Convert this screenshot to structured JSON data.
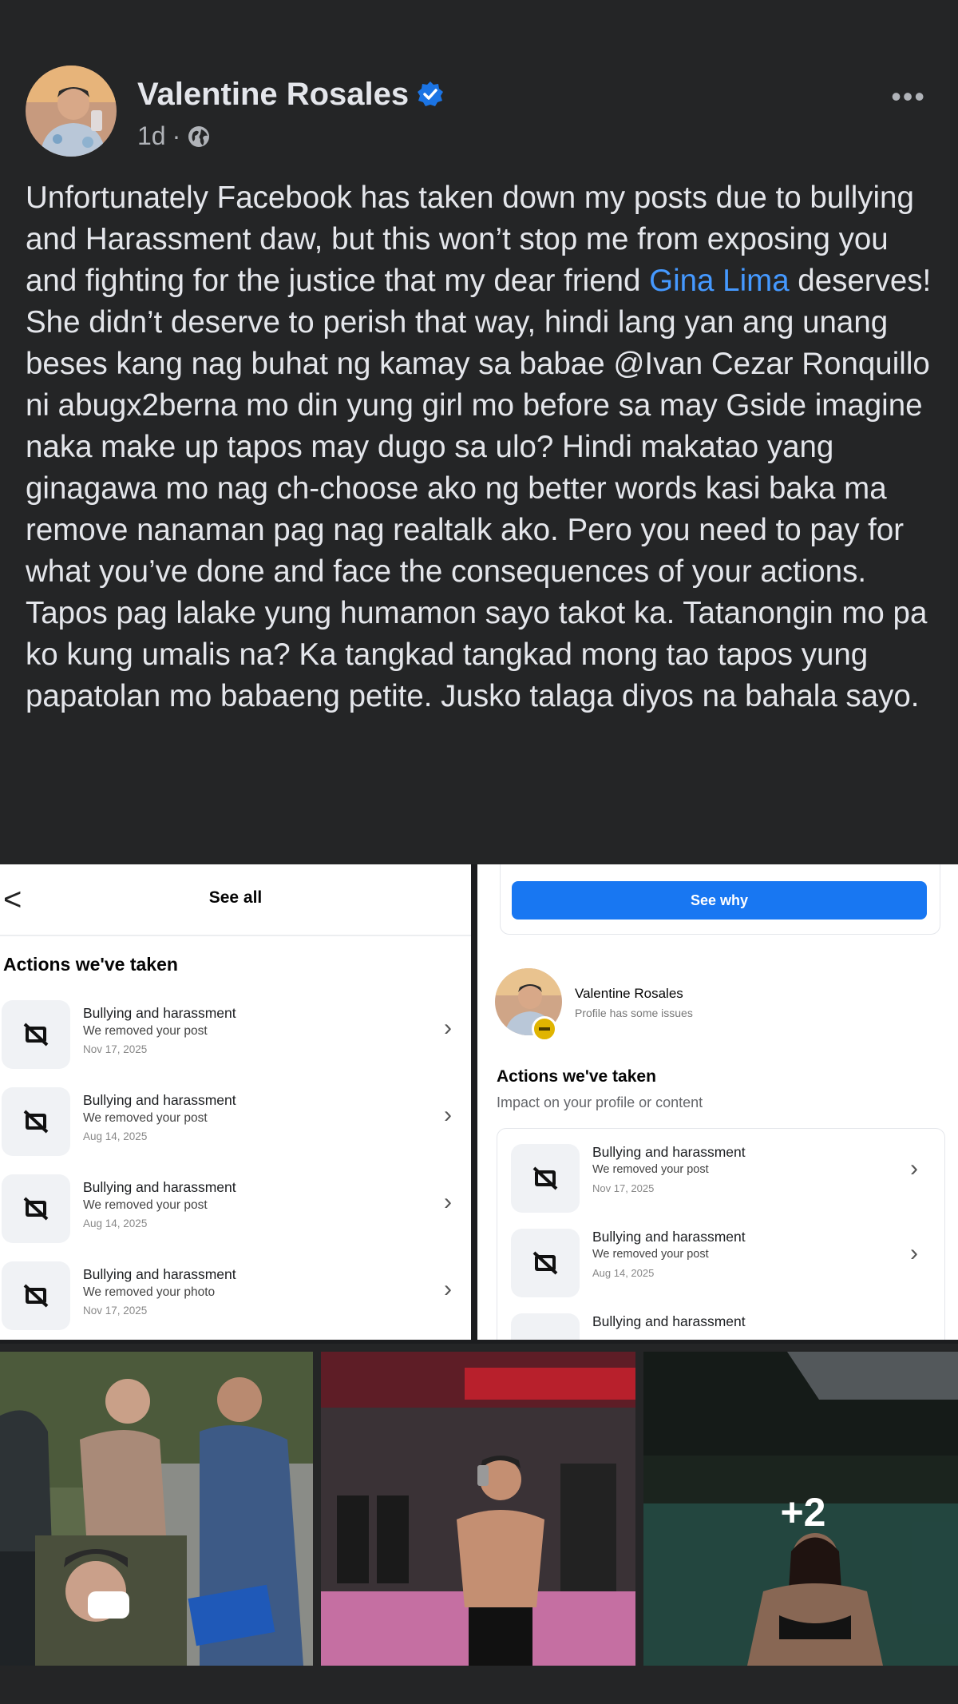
{
  "post": {
    "author": "Valentine Rosales",
    "time": "1d",
    "dot": "·",
    "more": "•••",
    "text_before": "Unfortunately Facebook has taken down my posts due to bullying and Harassment daw, but this won’t stop me from exposing you and fighting for the justice that my dear friend ",
    "mention": "Gina Lima",
    "text_after": " deserves! She didn’t deserve to perish that way, hindi lang yan ang unang beses kang nag buhat ng kamay sa babae @Ivan Cezar Ronquillo ni abugx2berna mo din yung girl mo before sa may Gside imagine naka make up tapos may dugo sa ulo? Hindi makatao yang ginagawa mo nag ch-choose ako ng better words kasi baka ma remove nanaman pag nag realtalk ako. Pero you need to pay for what you’ve done and face the consequences of your actions. Tapos pag lalake yung humamon sayo takot ka. Tatanongin mo pa ko kung umalis na? Ka tangkad tangkad mong tao tapos yung papatolan mo babaeng petite. Jusko talaga diyos na bahala sayo."
  },
  "left_screenshot": {
    "back": "<",
    "header": "See all",
    "section": "Actions we've taken",
    "items": [
      {
        "title": "Bullying and harassment",
        "sub": "We removed your post",
        "date": "Nov 17, 2025"
      },
      {
        "title": "Bullying and harassment",
        "sub": "We removed your post",
        "date": "Aug 14, 2025"
      },
      {
        "title": "Bullying and harassment",
        "sub": "We removed your post",
        "date": "Aug 14, 2025"
      },
      {
        "title": "Bullying and harassment",
        "sub": "We removed your photo",
        "date": "Nov 17, 2025"
      }
    ]
  },
  "right_screenshot": {
    "button": "See why",
    "profile_name": "Valentine Rosales",
    "profile_status": "Profile has some issues",
    "section": "Actions we've taken",
    "section_sub": "Impact on your profile or content",
    "items": [
      {
        "title": "Bullying and harassment",
        "sub": "We removed your post",
        "date": "Nov 17, 2025"
      },
      {
        "title": "Bullying and harassment",
        "sub": "We removed your post",
        "date": "Aug 14, 2025"
      },
      {
        "title": "Bullying and harassment",
        "sub": "",
        "date": ""
      }
    ]
  },
  "photos": {
    "more_count": "+2"
  },
  "colors": {
    "background": "#242526",
    "link": "#4599ff",
    "button": "#1877f2",
    "verified": "#1b74e4"
  },
  "icons": [
    "verified-badge-icon",
    "globe-icon",
    "more-icon",
    "back-icon",
    "hidden-content-icon",
    "chevron-right-icon"
  ]
}
